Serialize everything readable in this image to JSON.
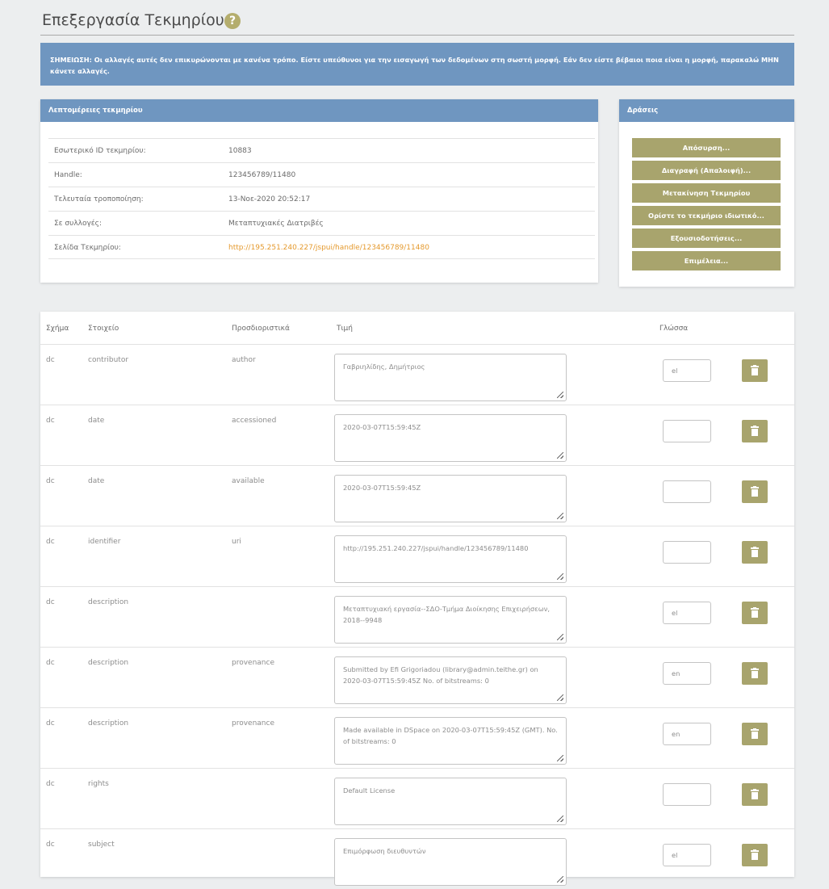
{
  "page": {
    "title": "Επεξεργασία Τεκμηρίου",
    "help_icon": "?"
  },
  "note": {
    "text": "ΣΗΜΕΙΩΣΗ: Οι αλλαγές αυτές δεν επικυρώνονται με κανένα τρόπο. Είστε υπεύθυνοι για την εισαγωγή των δεδομένων στη σωστή μορφή. Εάν δεν είστε βέβαιοι ποια είναι η μορφή, παρακαλώ ΜΗΝ κάνετε αλλαγές."
  },
  "details": {
    "heading": "Λεπτομέρειες τεκμηρίου",
    "rows": [
      {
        "label": "Εσωτερικό ID τεκμηρίου:",
        "value": "10883"
      },
      {
        "label": "Handle:",
        "value": "123456789/11480"
      },
      {
        "label": "Τελευταία τροποποίηση:",
        "value": "13-Νοε-2020 20:52:17"
      },
      {
        "label": "Σε συλλογές:",
        "value": "Μεταπτυχιακές Διατριβές"
      },
      {
        "label": "Σελίδα Τεκμηρίου:",
        "value": "http://195.251.240.227/jspui/handle/123456789/11480"
      }
    ]
  },
  "actions": {
    "heading": "Δράσεις",
    "buttons": [
      "Απόσυρση...",
      "Διαγραφή (Απαλοιφή)...",
      "Μετακίνηση Τεκμηρίου",
      "Ορίστε το τεκμήριο ιδιωτικό...",
      "Εξουσιοδοτήσεις...",
      "Επιμέλεια..."
    ]
  },
  "metadata": {
    "headers": {
      "schema": "Σχήμα",
      "element": "Στοιχείο",
      "qualifier": "Προσδιοριστικά",
      "value": "Τιμή",
      "language": "Γλώσσα"
    },
    "rows": [
      {
        "schema": "dc",
        "element": "contributor",
        "qualifier": "author",
        "value": "Γαβριηλίδης, Δημήτριος",
        "language": "el"
      },
      {
        "schema": "dc",
        "element": "date",
        "qualifier": "accessioned",
        "value": "2020-03-07T15:59:45Z",
        "language": ""
      },
      {
        "schema": "dc",
        "element": "date",
        "qualifier": "available",
        "value": "2020-03-07T15:59:45Z",
        "language": ""
      },
      {
        "schema": "dc",
        "element": "identifier",
        "qualifier": "uri",
        "value": "http://195.251.240.227/jspui/handle/123456789/11480",
        "language": ""
      },
      {
        "schema": "dc",
        "element": "description",
        "qualifier": "",
        "value": "Μεταπτυχιακή εργασία--ΣΔΟ-Τμήμα Διοίκησης Επιχειρήσεων, 2018--9948",
        "language": "el"
      },
      {
        "schema": "dc",
        "element": "description",
        "qualifier": "provenance",
        "value": "Submitted by Efi Grigoriadou (library@admin.teithe.gr) on 2020-03-07T15:59:45Z No. of bitstreams: 0",
        "language": "en"
      },
      {
        "schema": "dc",
        "element": "description",
        "qualifier": "provenance",
        "value": "Made available in DSpace on 2020-03-07T15:59:45Z (GMT). No. of bitstreams: 0",
        "language": "en"
      },
      {
        "schema": "dc",
        "element": "rights",
        "qualifier": "",
        "value": "Default License",
        "language": ""
      },
      {
        "schema": "dc",
        "element": "subject",
        "qualifier": "",
        "value": "Επιμόρφωση διευθυντών",
        "language": "el"
      }
    ]
  },
  "colors": {
    "accent_blue": "#6f96c0",
    "button_olive": "#a8a46d",
    "link_orange": "#e59a2e"
  }
}
